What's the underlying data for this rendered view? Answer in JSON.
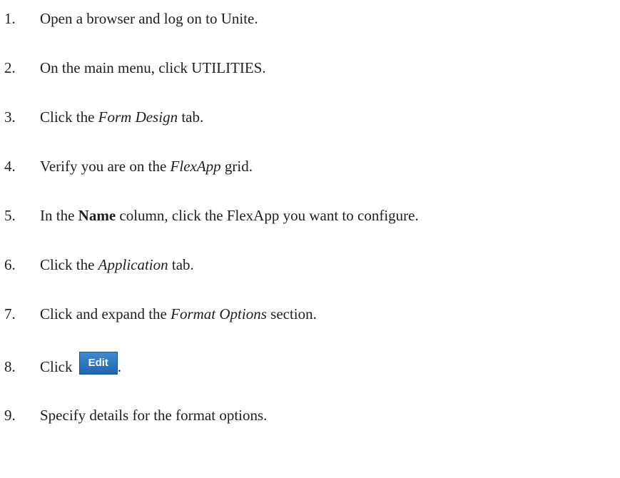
{
  "steps": [
    {
      "number": "1.",
      "parts": [
        "Open a browser and log on to Unite."
      ]
    },
    {
      "number": "2.",
      "parts": [
        "On the main menu, click UTILITIES."
      ]
    },
    {
      "number": "3.",
      "parts": [
        "Click the ",
        "Form Design",
        " tab."
      ]
    },
    {
      "number": "4.",
      "parts": [
        "Verify you are on the ",
        "FlexApp",
        " grid."
      ]
    },
    {
      "number": "5.",
      "parts": [
        "In the ",
        "Name",
        " column, click the FlexApp you want to configure."
      ]
    },
    {
      "number": "6.",
      "parts": [
        "Click the ",
        "Application",
        " tab."
      ]
    },
    {
      "number": "7.",
      "parts": [
        "Click and expand the ",
        "Format Options",
        " section."
      ]
    },
    {
      "number": "8.",
      "parts": [
        "Click ",
        "."
      ],
      "button_label": "Edit"
    },
    {
      "number": "9.",
      "parts": [
        "Specify details for the format options."
      ]
    }
  ],
  "colors": {
    "text": "#1e1e1e",
    "button": "#2a75c2",
    "button_text": "#ffffff"
  }
}
